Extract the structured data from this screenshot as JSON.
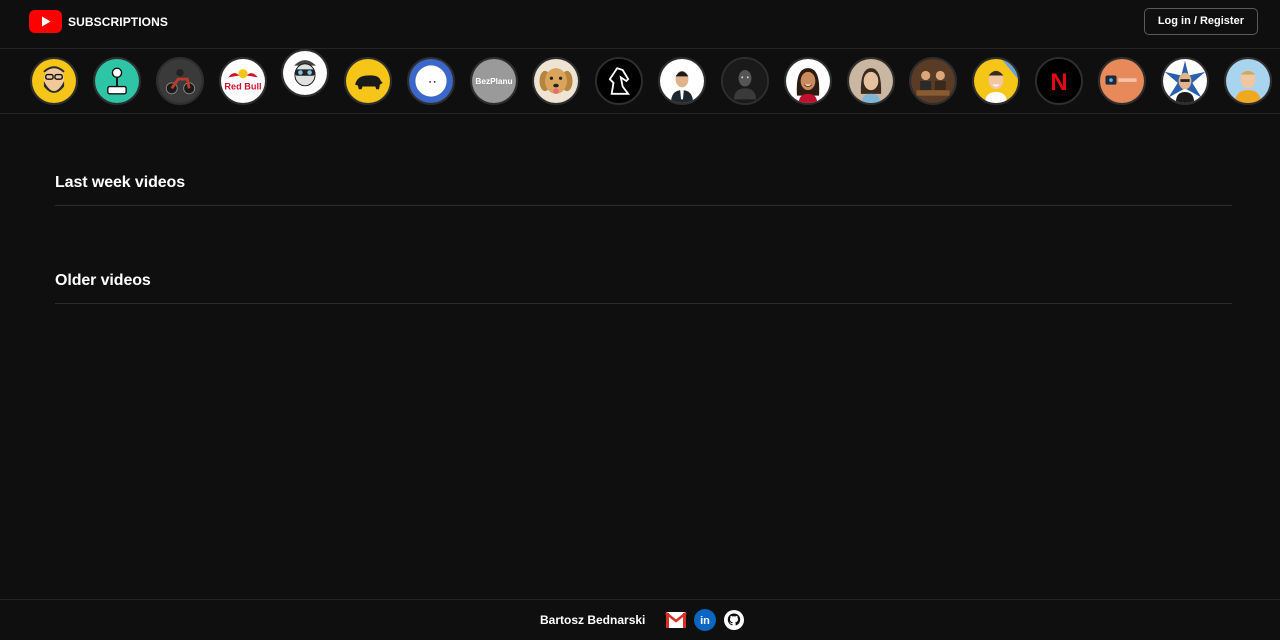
{
  "header": {
    "brand_title": "SUBSCRIPTIONS",
    "login_label": "Log in / Register",
    "logo_icon": "youtube-logo-icon",
    "accent_color": "#ff0000"
  },
  "channels": [
    {
      "icon": "bearded-man-cartoon-avatar",
      "bg": "#f5c518"
    },
    {
      "icon": "joystick-avatar",
      "bg": "#2ec4a6"
    },
    {
      "icon": "motorcycle-avatar",
      "bg": "#3a3a3a"
    },
    {
      "icon": "red-bull-logo-avatar",
      "bg": "#ffffff",
      "text": "Red Bull"
    },
    {
      "icon": "goggles-character-avatar",
      "bg": "#ffffff"
    },
    {
      "icon": "boar-silhouette-avatar",
      "bg": "#f5c518"
    },
    {
      "icon": "dots-face-avatar",
      "bg": "#3b67c9"
    },
    {
      "icon": "bezplanu-text-avatar",
      "bg": "#9a9a9a",
      "text": "BezPlanu"
    },
    {
      "icon": "golden-dog-avatar",
      "bg": "#d9b98a"
    },
    {
      "icon": "horse-head-avatar",
      "bg": "#000000"
    },
    {
      "icon": "man-in-suit-avatar",
      "bg": "#ffffff"
    },
    {
      "icon": "dark-portrait-avatar",
      "bg": "#1a1a1a"
    },
    {
      "icon": "smiling-woman-avatar",
      "bg": "#ffffff"
    },
    {
      "icon": "woman-portrait-avatar",
      "bg": "#c9b7a2"
    },
    {
      "icon": "group-photo-avatar",
      "bg": "#5a3b25"
    },
    {
      "icon": "man-yellow-bg-avatar",
      "bg": "#f5c518"
    },
    {
      "icon": "netflix-logo-avatar",
      "bg": "#000000",
      "text": "N"
    },
    {
      "icon": "orange-tech-avatar",
      "bg": "#e8895a"
    },
    {
      "icon": "man-star-bg-avatar",
      "bg": "#ffffff"
    },
    {
      "icon": "man-blue-sky-avatar",
      "bg": "#a8d4ef"
    }
  ],
  "sections": {
    "last_week": "Last week videos",
    "older": "Older videos"
  },
  "footer": {
    "author": "Bartosz Bednarski",
    "links": [
      {
        "icon": "gmail-icon"
      },
      {
        "icon": "linkedin-icon",
        "text": "in"
      },
      {
        "icon": "github-icon"
      }
    ]
  }
}
